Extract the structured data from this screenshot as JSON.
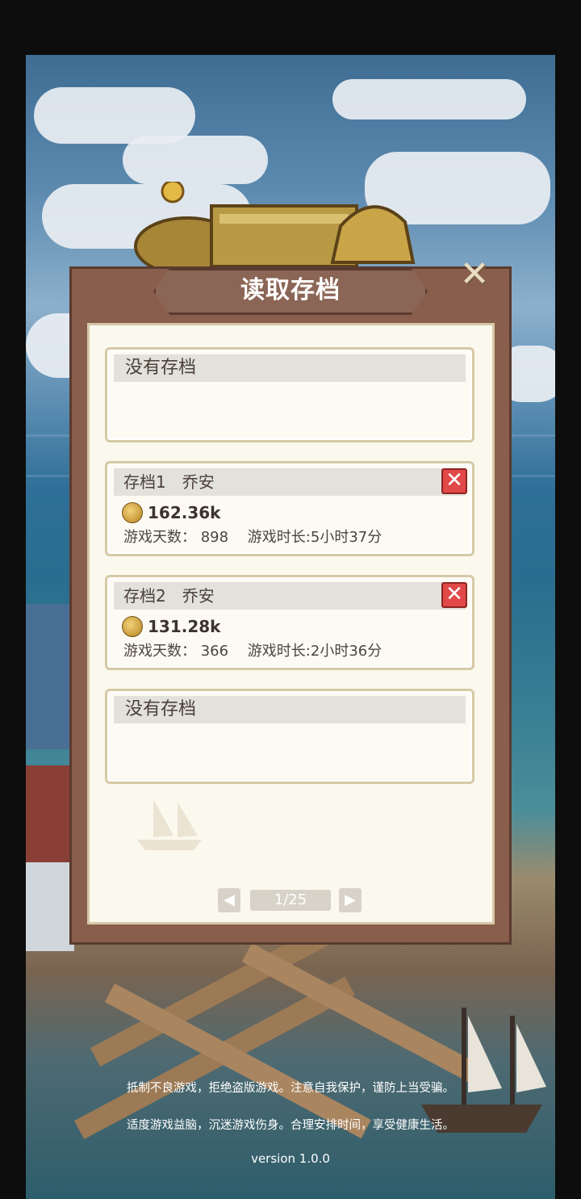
{
  "dialog": {
    "title": "读取存档"
  },
  "slots": [
    {
      "type": "empty",
      "label": "没有存档"
    },
    {
      "type": "save",
      "name": "存档1　乔安",
      "coins": "162.36k",
      "stats": "游戏天数： 898　 游戏时长:5小时37分"
    },
    {
      "type": "save",
      "name": "存档2　乔安",
      "coins": "131.28k",
      "stats": "游戏天数： 366　 游戏时长:2小时36分"
    },
    {
      "type": "empty",
      "label": "没有存档"
    }
  ],
  "pagination": {
    "label": "1/25",
    "prev_icon": "◀",
    "next_icon": "▶"
  },
  "close_icon": "✕",
  "delete_icon": "✕",
  "footer": {
    "notice1": "抵制不良游戏，拒绝盗版游戏。注意自我保护，谨防上当受骗。",
    "notice2": "适度游戏益脑，沉迷游戏伤身。合理安排时间，享受健康生活。",
    "version": "version 1.0.0"
  },
  "colors": {
    "frame": "#8a5e4c",
    "paper": "#fbf8ee",
    "delete": "#e14848"
  }
}
